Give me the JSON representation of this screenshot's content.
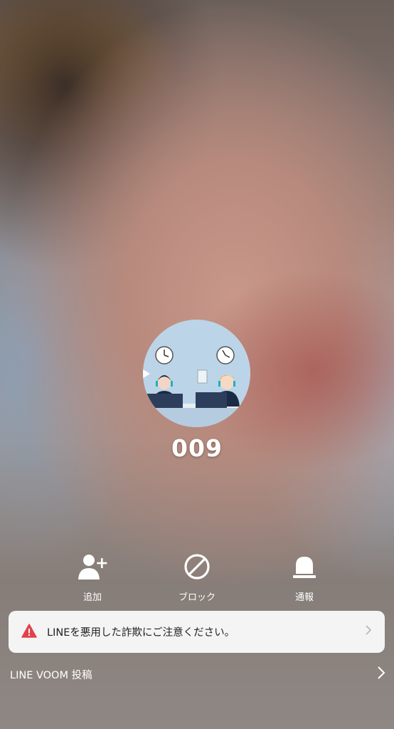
{
  "profile": {
    "name": "009"
  },
  "actions": [
    {
      "label": "追加",
      "icon": "add-friend-icon"
    },
    {
      "label": "ブロック",
      "icon": "block-icon"
    },
    {
      "label": "通報",
      "icon": "report-icon"
    }
  ],
  "notice": {
    "text": "LINEを悪用した詐欺にご注意ください。",
    "icon": "warning-icon",
    "icon_color": "#e0424a"
  },
  "voom": {
    "label": "LINE VOOM 投稿",
    "icon": "chevron-right-icon"
  }
}
